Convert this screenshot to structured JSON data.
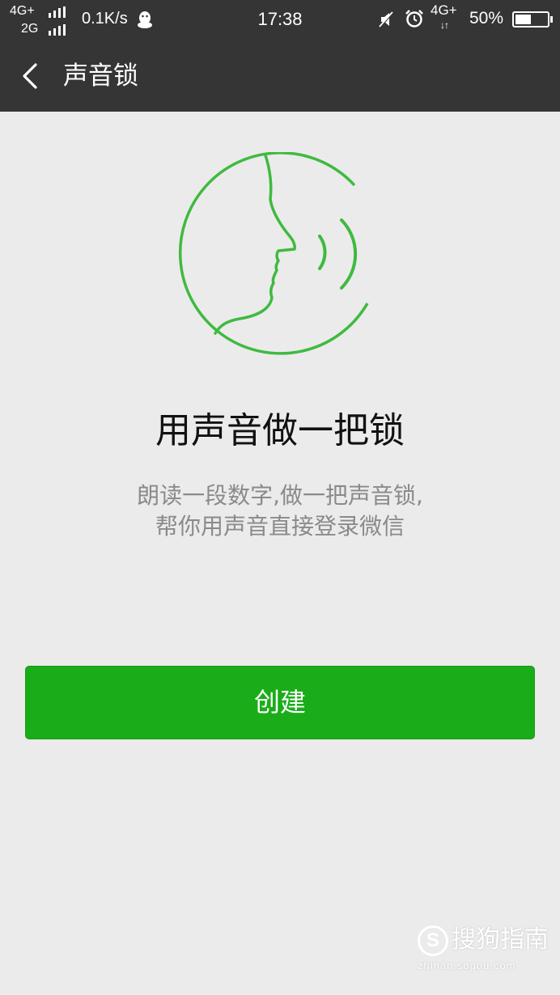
{
  "status_bar": {
    "network_primary": "4G+",
    "network_secondary": "2G",
    "speed": "0.1K/s",
    "time": "17:38",
    "data_network": "4G+",
    "data_arrows": "↓↑",
    "battery_text": "50%",
    "battery_level": 0.5,
    "icons": [
      "signal-bars-icon",
      "qq-penguin-icon",
      "mute-icon",
      "alarm-icon",
      "battery-icon"
    ]
  },
  "navbar": {
    "back_icon": "chevron-left-icon",
    "title": "声音锁"
  },
  "hero": {
    "icon": "voice-face-icon",
    "accent_color": "#3fba3f"
  },
  "content": {
    "headline": "用声音做一把锁",
    "description_line1": "朗读一段数字,做一把声音锁,",
    "description_line2": "帮你用声音直接登录微信"
  },
  "actions": {
    "create_label": "创建",
    "button_color": "#1aad19"
  },
  "watermark": {
    "logo_letter": "S",
    "name": "搜狗指南",
    "domain": "zhinan.sogou.com"
  }
}
